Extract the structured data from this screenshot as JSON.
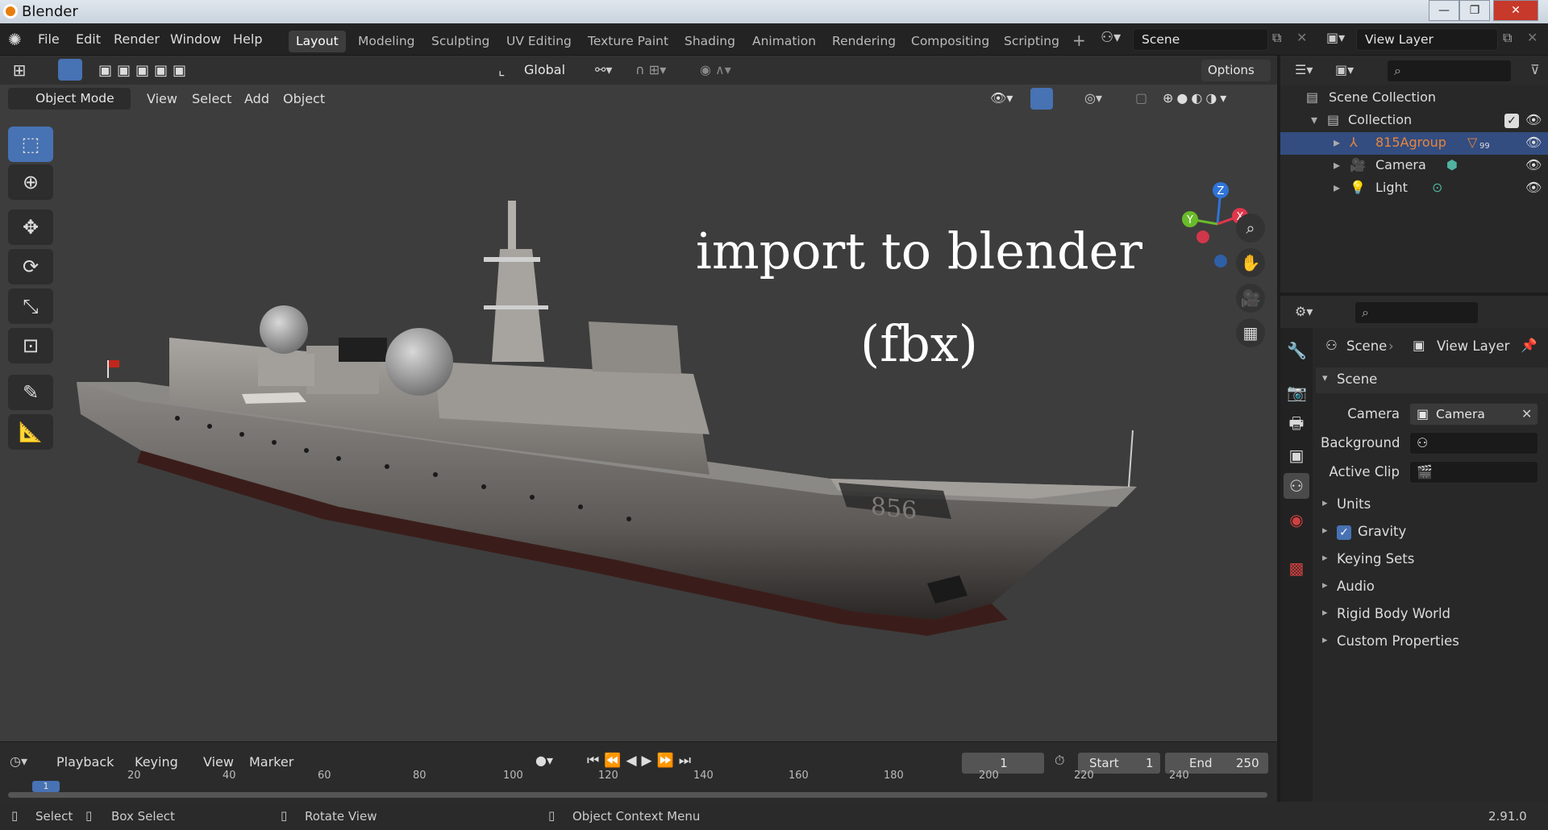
{
  "window": {
    "app_title": "Blender",
    "min": "—",
    "max": "❐",
    "close": "✕"
  },
  "menus": [
    "File",
    "Edit",
    "Render",
    "Window",
    "Help"
  ],
  "workspace_tabs": [
    "Layout",
    "Modeling",
    "Sculpting",
    "UV Editing",
    "Texture Paint",
    "Shading",
    "Animation",
    "Rendering",
    "Compositing",
    "Scripting"
  ],
  "active_tab": "Layout",
  "scene_field": "Scene",
  "view_layer_field": "View Layer",
  "viewport": {
    "orientation": "Global",
    "options_label": "Options",
    "mode": "Object Mode",
    "header_menus": [
      "View",
      "Select",
      "Add",
      "Object"
    ],
    "overlay_line1": "import to blender",
    "overlay_line2": "(fbx)",
    "gizmo": {
      "z": "Z",
      "y": "Y",
      "x": "X"
    }
  },
  "outliner": {
    "root": "Scene Collection",
    "collection": "Collection",
    "items": [
      {
        "name": "815Agroup",
        "badge": "99",
        "highlight": true
      },
      {
        "name": "Camera"
      },
      {
        "name": "Light"
      }
    ]
  },
  "properties": {
    "breadcrumb_scene": "Scene",
    "breadcrumb_layer": "View Layer",
    "section": "Scene",
    "camera_label": "Camera",
    "camera_value": "Camera",
    "background_label": "Background ...",
    "active_clip_label": "Active Clip",
    "panels": [
      "Units",
      "Gravity",
      "Keying Sets",
      "Audio",
      "Rigid Body World",
      "Custom Properties"
    ],
    "gravity_checked": true
  },
  "timeline": {
    "menus": [
      "Playback",
      "Keying",
      "View",
      "Marker"
    ],
    "current_frame": "1",
    "start_label": "Start",
    "start_value": "1",
    "end_label": "End",
    "end_value": "250",
    "ticks": [
      "1",
      "20",
      "40",
      "60",
      "80",
      "100",
      "120",
      "140",
      "160",
      "180",
      "200",
      "220",
      "240"
    ]
  },
  "status": {
    "select": "Select",
    "box_select": "Box Select",
    "rotate_view": "Rotate View",
    "context_menu": "Object Context Menu",
    "version": "2.91.0"
  },
  "ship_hull_number": "856",
  "colors": {
    "accent": "#4772b3",
    "highlight_text": "#e8853b",
    "viewport_bg": "#3d3d3d",
    "panel_bg": "#282828"
  }
}
